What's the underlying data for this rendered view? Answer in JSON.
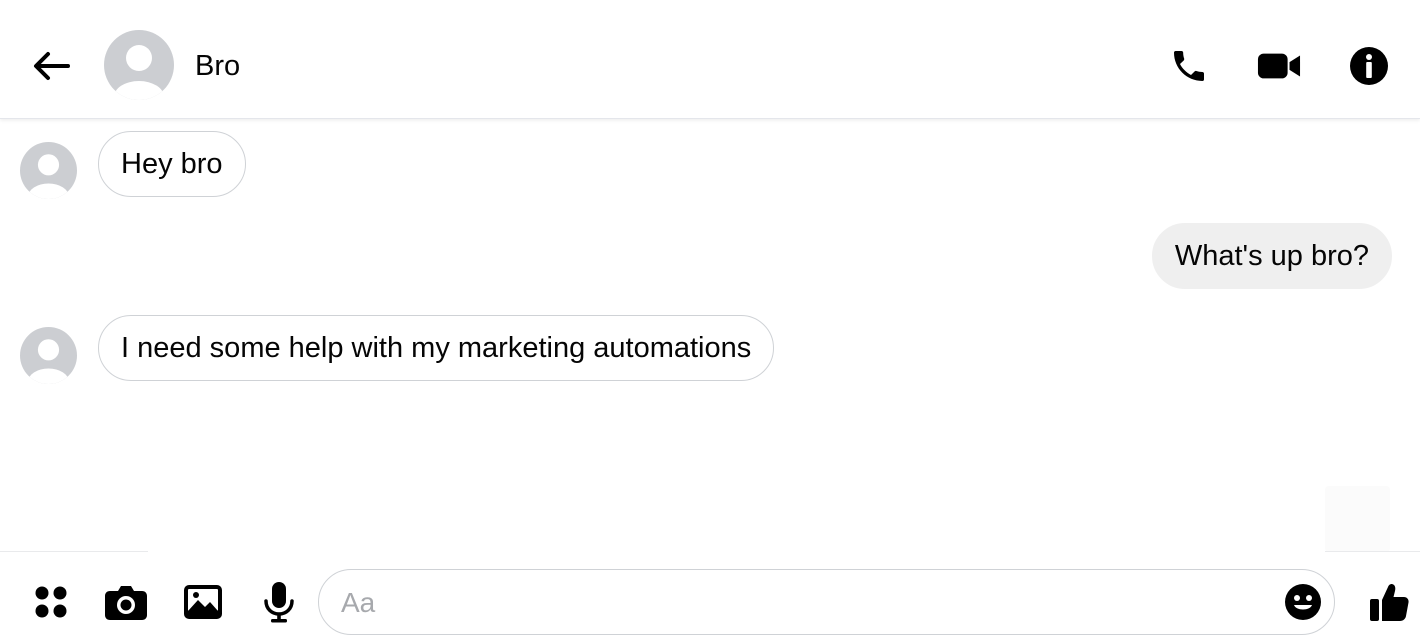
{
  "header": {
    "contact_name": "Bro",
    "icons": {
      "back": "arrow-left-icon",
      "call": "phone-icon",
      "video": "video-camera-icon",
      "info": "info-icon"
    }
  },
  "messages": [
    {
      "direction": "incoming",
      "text": "Hey bro"
    },
    {
      "direction": "outgoing",
      "text": "What's up bro?"
    },
    {
      "direction": "incoming",
      "text": "I need some help with my marketing automations"
    }
  ],
  "composer": {
    "placeholder": "Aa",
    "value": "",
    "icons": {
      "more": "four-dots-icon",
      "camera": "camera-icon",
      "gallery": "image-icon",
      "voice": "microphone-icon",
      "emoji": "smiley-icon",
      "like": "thumbs-up-icon"
    }
  },
  "colors": {
    "icon": "#000000",
    "avatar_bg": "#ccced2",
    "incoming_border": "#cfd2d6",
    "outgoing_bg": "#efefef",
    "placeholder": "#a7a9ad"
  }
}
